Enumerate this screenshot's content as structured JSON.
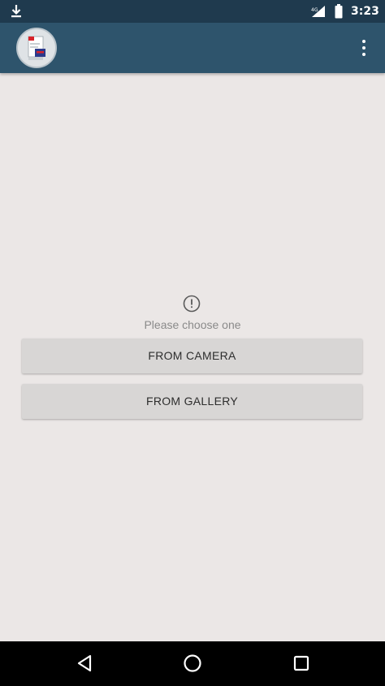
{
  "status_bar": {
    "time": "3:23",
    "icons": [
      "download-icon",
      "signal-icon",
      "battery-icon"
    ]
  },
  "app_bar": {
    "logo": "app-logo-icon",
    "menu_icon": "overflow-menu-icon"
  },
  "main": {
    "info_icon": "info-icon",
    "prompt": "Please choose one",
    "buttons": [
      {
        "label": "FROM CAMERA"
      },
      {
        "label": "FROM GALLERY"
      }
    ]
  },
  "nav_bar": {
    "icons": [
      "back-icon",
      "home-icon",
      "recents-icon"
    ]
  },
  "colors": {
    "status_bar": "#1f3a4e",
    "app_bar": "#2e546c",
    "background": "#ebe7e6",
    "button": "#d8d6d5"
  }
}
